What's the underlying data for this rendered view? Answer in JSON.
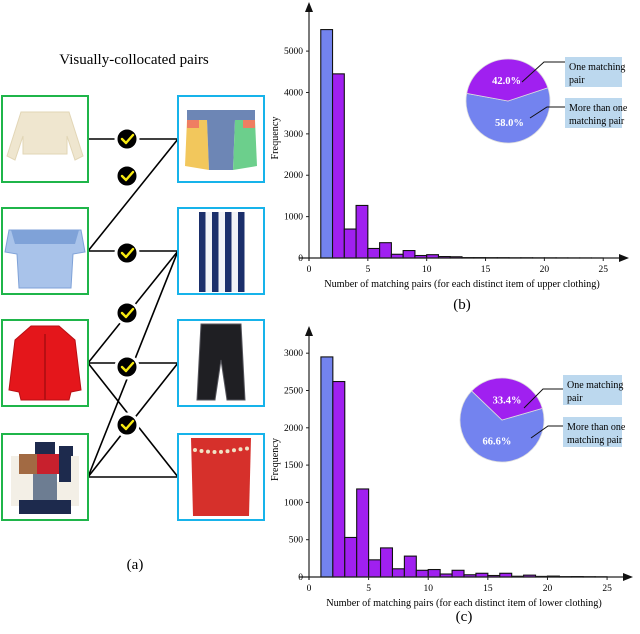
{
  "panel_a": {
    "title": "Visually-collocated pairs",
    "caption": "(a)",
    "upper_items": [
      {
        "name": "cream-cropped-sweater",
        "label": "Cream cropped sweater",
        "colors": [
          "#efe6cf",
          "#e2d6b6"
        ]
      },
      {
        "name": "blue-off-shoulder-top",
        "label": "Blue striped off-shoulder ruffle top",
        "colors": [
          "#a9c3ea",
          "#7fa2d8"
        ]
      },
      {
        "name": "red-blazer",
        "label": "Red open blazer",
        "colors": [
          "#e4161b",
          "#b80f13"
        ]
      },
      {
        "name": "patchwork-sweater",
        "label": "Patchwork knit sweater",
        "colors": [
          "#1d2a4d",
          "#c8202d",
          "#a26a43",
          "#f3efe6",
          "#6d7d92"
        ]
      }
    ],
    "lower_items": [
      {
        "name": "colorblock-denim-shorts",
        "label": "Color-block denim shorts",
        "colors": [
          "#6d86b5",
          "#f2c75c",
          "#6ccf8c",
          "#ef7e62"
        ]
      },
      {
        "name": "striped-wide-pants",
        "label": "Blue/white striped wide pants",
        "colors": [
          "#1b2f6b",
          "#f1f3f7"
        ]
      },
      {
        "name": "black-sheer-pants",
        "label": "Black sheer layered pants",
        "colors": [
          "#1f1f23",
          "#55555c"
        ]
      },
      {
        "name": "red-pencil-skirt",
        "label": "Red pencil skirt with chain belt",
        "colors": [
          "#d6302b",
          "#f1e3c5"
        ]
      }
    ],
    "pairs": [
      {
        "upper": 0,
        "lower": 0,
        "matched": true
      },
      {
        "upper": 1,
        "lower": 0,
        "matched": true
      },
      {
        "upper": 1,
        "lower": 1,
        "matched": true
      },
      {
        "upper": 2,
        "lower": 1,
        "matched": true
      },
      {
        "upper": 2,
        "lower": 2,
        "matched": true
      },
      {
        "upper": 2,
        "lower": 3,
        "matched": true
      },
      {
        "upper": 3,
        "lower": 1,
        "matched": true
      },
      {
        "upper": 3,
        "lower": 2,
        "matched": true
      },
      {
        "upper": 3,
        "lower": 3,
        "matched": true
      }
    ],
    "colors": {
      "upper_border": "#1fb54a",
      "lower_border": "#17b3ea",
      "check_bg": "#000000",
      "check_mark": "#f7ea12"
    }
  },
  "chart_data": [
    {
      "id": "b",
      "type": "bar",
      "caption": "(b)",
      "title": "",
      "xlabel": "Number of matching pairs (for each distinct item of upper clothing)",
      "ylabel": "Frequency",
      "xlim": [
        0,
        26
      ],
      "ylim": [
        0,
        5800
      ],
      "xticks": [
        0,
        5,
        10,
        15,
        20,
        25
      ],
      "yticks": [
        0,
        1000,
        2000,
        3000,
        4000,
        5000
      ],
      "bin_width": 1,
      "bins_start": [
        1,
        2,
        3,
        4,
        5,
        6,
        7,
        8,
        9,
        10,
        11,
        12,
        13,
        14,
        15,
        16,
        17,
        18,
        19,
        20,
        21,
        22,
        23,
        24
      ],
      "values": [
        5520,
        4450,
        700,
        1270,
        230,
        370,
        90,
        180,
        60,
        80,
        35,
        30,
        10,
        10,
        8,
        8,
        5,
        6,
        4,
        4,
        3,
        2,
        2,
        1
      ],
      "highlight_first_bin": true,
      "grid": false,
      "series_colors": {
        "one": "#7383ef",
        "more": "#a020f0"
      },
      "inset_pie": {
        "type": "pie",
        "slices": [
          {
            "label": "One matching pair",
            "value": 58.0,
            "text": "58.0%",
            "color": "#7383ef"
          },
          {
            "label": "More than one matching pair",
            "value": 42.0,
            "text": "42.0%",
            "color": "#a020f0"
          }
        ],
        "legend_placement": "right",
        "label_bg": "#bcd8ee"
      }
    },
    {
      "id": "c",
      "type": "bar",
      "caption": "(c)",
      "title": "",
      "xlabel": "Number of matching pairs (for each distinct item of lower clothing)",
      "ylabel": "Frequency",
      "xlim": [
        0,
        26
      ],
      "ylim": [
        0,
        3150
      ],
      "xticks": [
        0,
        5,
        10,
        15,
        20,
        25
      ],
      "yticks": [
        0,
        500,
        1000,
        1500,
        2000,
        2500,
        3000
      ],
      "bin_width": 1,
      "bins_start": [
        1,
        2,
        3,
        4,
        5,
        6,
        7,
        8,
        9,
        10,
        11,
        12,
        13,
        14,
        15,
        16,
        17,
        18,
        19,
        20,
        21,
        22,
        23,
        24
      ],
      "values": [
        2950,
        2620,
        530,
        1180,
        230,
        390,
        110,
        280,
        90,
        100,
        40,
        90,
        30,
        50,
        20,
        50,
        10,
        25,
        8,
        12,
        5,
        6,
        4,
        3
      ],
      "highlight_first_bin": true,
      "grid": false,
      "series_colors": {
        "one": "#7383ef",
        "more": "#a020f0"
      },
      "inset_pie": {
        "type": "pie",
        "slices": [
          {
            "label": "One matching pair",
            "value": 66.6,
            "text": "66.6%",
            "color": "#7383ef"
          },
          {
            "label": "More than one matching pair",
            "value": 33.4,
            "text": "33.4%",
            "color": "#a020f0"
          }
        ],
        "legend_placement": "right",
        "label_bg": "#bcd8ee"
      }
    }
  ]
}
